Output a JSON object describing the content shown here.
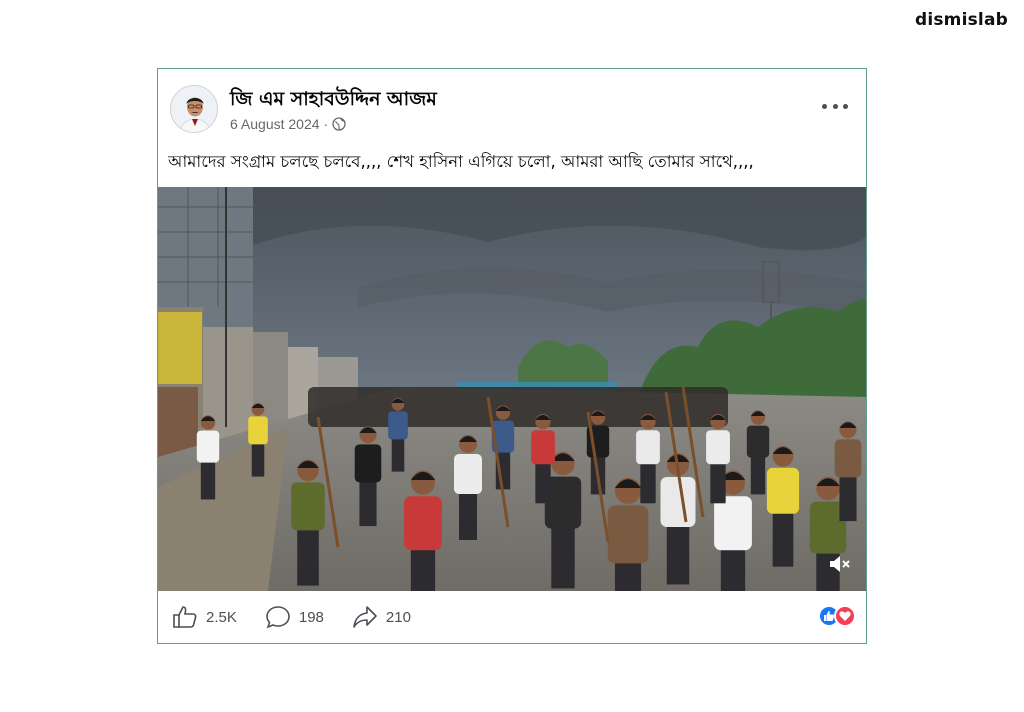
{
  "brand": {
    "name": "dismislab"
  },
  "post": {
    "author": "জি এম সাহাবউদ্দিন আজম",
    "date": "6 August 2024",
    "separator": "·",
    "audience_icon": "globe-icon",
    "more_icon": "more-options-icon",
    "caption": "আমাদের সংগ্রাম চলছে চলবে,,,, শেখ হাসিনা এগিয়ে চলো, আমরা আছি তোমার সাথে,,,,",
    "video": {
      "mute_icon": "volume-muted-icon"
    },
    "engagement": {
      "likes": "2.5K",
      "comments": "198",
      "shares": "210",
      "reactions": [
        "like-reaction-icon",
        "love-reaction-icon"
      ]
    }
  },
  "colors": {
    "border": "#5f9e8a",
    "like_blue": "#1877f2",
    "love_red": "#f33e58",
    "meta_gray": "#65676b"
  }
}
